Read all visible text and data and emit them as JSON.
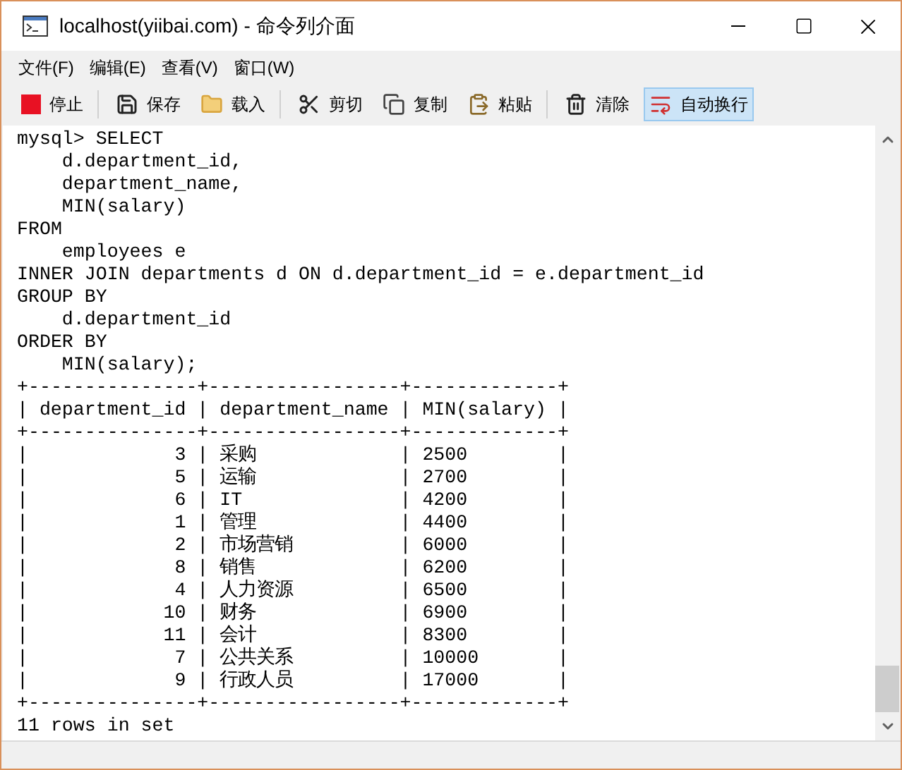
{
  "window": {
    "title": "localhost(yiibai.com) - 命令列介面"
  },
  "menu": [
    "文件(F)",
    "编辑(E)",
    "查看(V)",
    "窗口(W)"
  ],
  "toolbar": [
    {
      "kind": "stop",
      "label": "停止",
      "on": false,
      "divider_after": true
    },
    {
      "kind": "save",
      "label": "保存",
      "on": false
    },
    {
      "kind": "load",
      "label": "载入",
      "on": false,
      "divider_after": true
    },
    {
      "kind": "cut",
      "label": "剪切",
      "on": false
    },
    {
      "kind": "copy",
      "label": "复制",
      "on": false
    },
    {
      "kind": "paste",
      "label": "粘贴",
      "on": false,
      "divider_after": true
    },
    {
      "kind": "clear",
      "label": "清除",
      "on": false
    },
    {
      "kind": "wrap",
      "label": "自动换行",
      "on": true
    }
  ],
  "console": {
    "lines": [
      "mysql> SELECT",
      "    d.department_id,",
      "    department_name,",
      "    MIN(salary)",
      "FROM",
      "    employees e",
      "INNER JOIN departments d ON d.department_id = e.department_id",
      "GROUP BY",
      "    d.department_id",
      "ORDER BY",
      "    MIN(salary);"
    ],
    "table": {
      "border": "+---------------+-----------------+-------------+",
      "separator": "|",
      "columns": [
        "department_id",
        "department_name",
        "MIN(salary)"
      ],
      "rows": [
        [
          "3",
          "采购",
          "2500"
        ],
        [
          "5",
          "运输",
          "2700"
        ],
        [
          "6",
          "IT",
          "4200"
        ],
        [
          "1",
          "管理",
          "4400"
        ],
        [
          "2",
          "市场营销",
          "6000"
        ],
        [
          "8",
          "销售",
          "6200"
        ],
        [
          "4",
          "人力资源",
          "6500"
        ],
        [
          "10",
          "财务",
          "6900"
        ],
        [
          "11",
          "会计",
          "8300"
        ],
        [
          "7",
          "公共关系",
          "10000"
        ],
        [
          "9",
          "行政人员",
          "17000"
        ]
      ]
    },
    "footer": "11 rows in set"
  }
}
